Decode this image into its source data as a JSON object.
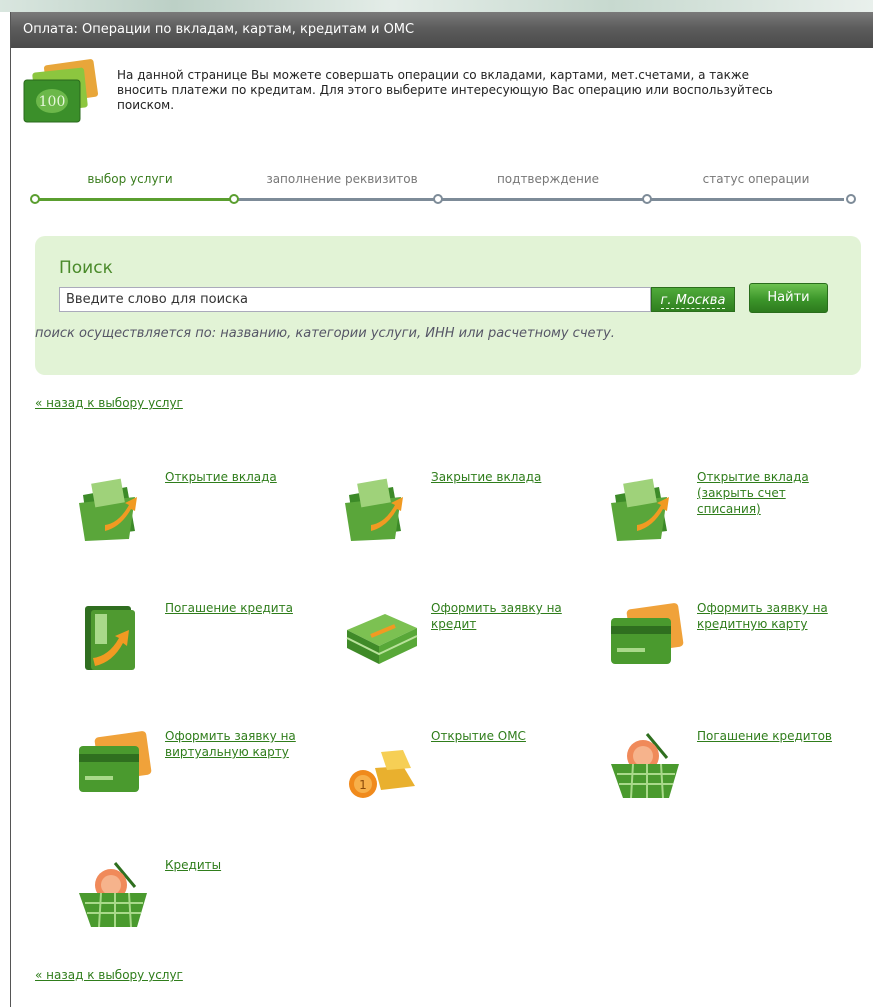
{
  "window": {
    "title": "Оплата: Операции по вкладам, картам, кредитам и ОМС"
  },
  "intro": {
    "line1": "На данной странице Вы можете совершать операции со вкладами, картами, мет.счетами, а также",
    "line2": "вносить платежи по кредитам. Для этого выберите интересующую Вас операцию или воспользуйтесь",
    "line3": "поиском."
  },
  "steps": [
    {
      "label": "выбор услуги",
      "active": true
    },
    {
      "label": "заполнение реквизитов",
      "active": false
    },
    {
      "label": "подтверждение",
      "active": false
    },
    {
      "label": "статус операции",
      "active": false
    }
  ],
  "search": {
    "title": "Поиск",
    "value": "Введите слово для поиска",
    "city": "г. Москва",
    "button": "Найти",
    "hint": "поиск осуществляется по: названию, категории услуги, ИНН или расчетному счету."
  },
  "back_link": "« назад к выбору услуг",
  "services": [
    {
      "label": "Открытие вклада",
      "icon": "deposit-folder-icon"
    },
    {
      "label": "Закрытие вклада",
      "icon": "deposit-folder-icon"
    },
    {
      "label": "Открытие вклада (закрыть счет списания)",
      "icon": "deposit-folder-icon"
    },
    {
      "label": "Погашение кредита",
      "icon": "wallet-arrow-icon"
    },
    {
      "label": "Оформить заявку на кредит",
      "icon": "money-stack-icon"
    },
    {
      "label": "Оформить заявку на кредитную карту",
      "icon": "credit-card-icon"
    },
    {
      "label": "Оформить заявку на виртуальную карту",
      "icon": "credit-card-icon"
    },
    {
      "label": "Открытие ОМС",
      "icon": "gold-bars-icon"
    },
    {
      "label": "Погашение кредитов",
      "icon": "coin-basket-icon"
    },
    {
      "label": "Кредиты",
      "icon": "coin-basket-icon"
    }
  ],
  "colors": {
    "accent_green": "#3a7d1e",
    "search_bg": "#e2f3d6",
    "title_bar": "#5c5c5c",
    "step_inactive": "#7d8b98"
  }
}
